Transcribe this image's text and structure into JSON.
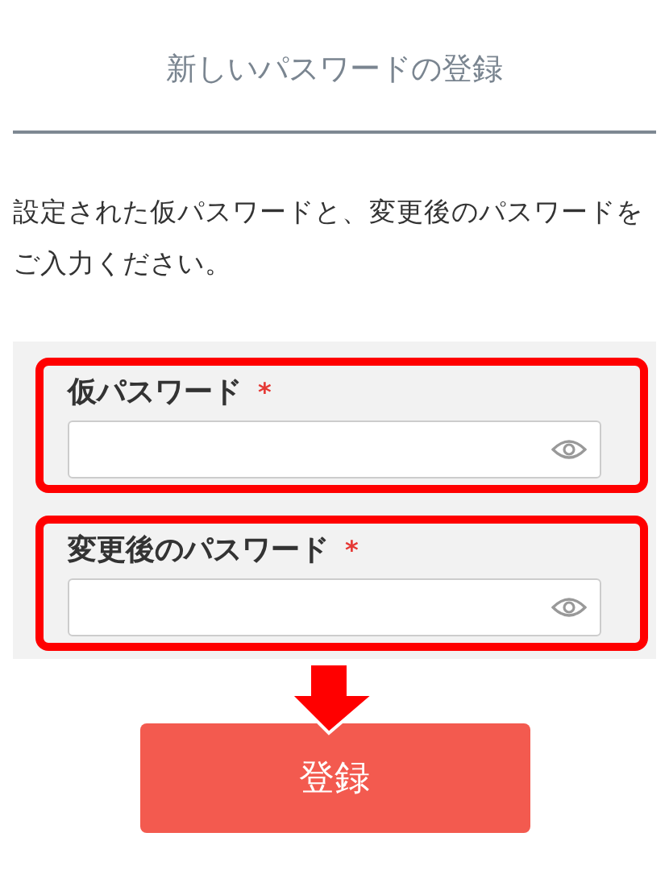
{
  "title": "新しいパスワードの登録",
  "description": "設定された仮パスワードと、変更後のパスワードをご入力ください。",
  "fields": [
    {
      "label": "仮パスワード",
      "required_mark": "*",
      "highlighted": true
    },
    {
      "label": "変更後のパスワード",
      "required_mark": "*",
      "highlighted": true
    }
  ],
  "submit_button": {
    "label": "登録",
    "pointer_arrow": true
  }
}
